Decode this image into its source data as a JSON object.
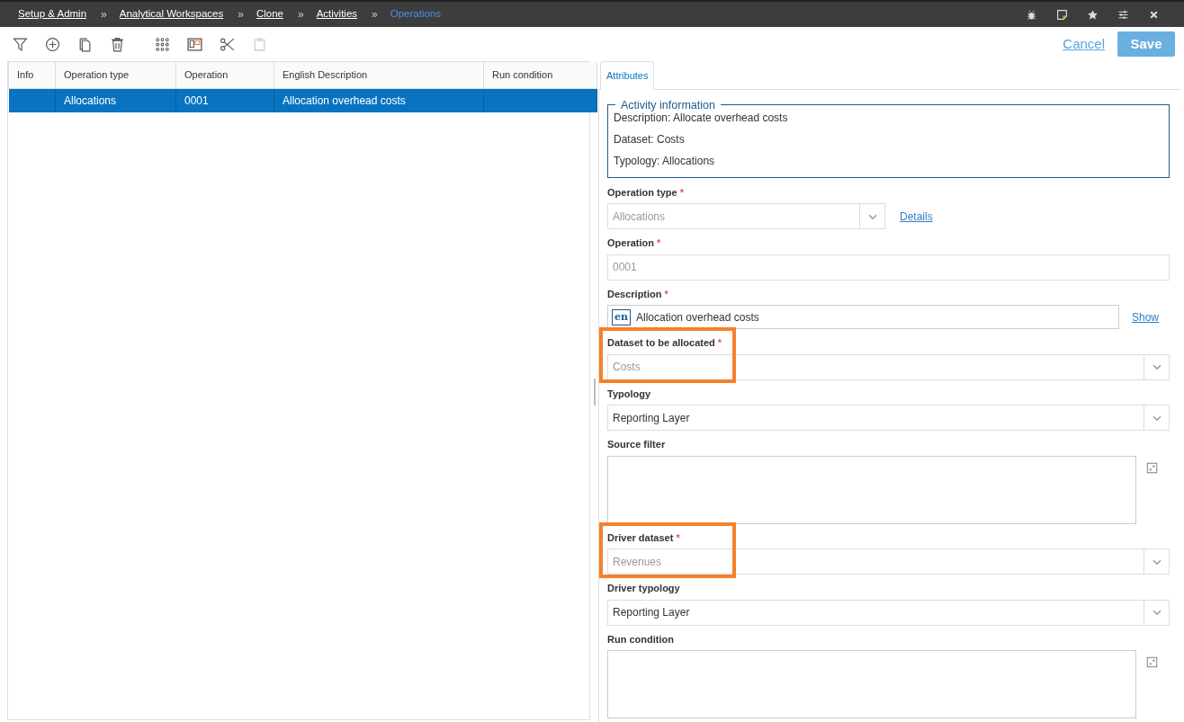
{
  "breadcrumbs": [
    {
      "label": "Setup & Admin",
      "current": false
    },
    {
      "label": "Analytical Workspaces",
      "current": false
    },
    {
      "label": "Clone",
      "current": false
    },
    {
      "label": "Activities",
      "current": false
    },
    {
      "label": "Operations",
      "current": true
    }
  ],
  "separator": "»",
  "required_mark": "*",
  "toolbar": [
    {
      "disabled": false
    },
    {
      "disabled": false
    },
    {
      "disabled": false
    },
    {
      "disabled": false
    },
    {
      "disabled": false
    },
    {
      "disabled": false
    },
    {
      "disabled": false
    },
    {
      "disabled": true
    }
  ],
  "actions": {
    "cancel": "Cancel",
    "save": "Save"
  },
  "table": {
    "columns": [
      "Info",
      "Operation type",
      "Operation",
      "English Description",
      "Run condition"
    ],
    "rows": [
      {
        "selected": true,
        "cells": [
          "",
          "Allocations",
          "0001",
          "Allocation overhead costs",
          ""
        ]
      }
    ]
  },
  "tabs": [
    {
      "label": "Attributes",
      "selected": true
    }
  ],
  "activity_info": {
    "title": "Activity information",
    "lines": [
      "Description: Allocate overhead costs",
      "Dataset: Costs",
      "Typology: Allocations"
    ]
  },
  "fields": [
    {
      "kind": "select",
      "label": "Operation type",
      "required": true,
      "disabled": true,
      "value": "Allocations",
      "link": "Details",
      "highlighted": false
    },
    {
      "kind": "text",
      "label": "Operation",
      "required": true,
      "disabled": true,
      "value": "0001",
      "highlighted": false
    },
    {
      "kind": "lang",
      "label": "Description",
      "required": true,
      "disabled": false,
      "lang": "en",
      "value": "Allocation overhead costs",
      "link": "Show",
      "highlighted": false
    },
    {
      "kind": "select",
      "label": "Dataset to be allocated",
      "required": true,
      "disabled": true,
      "value": "Costs",
      "highlighted": true
    },
    {
      "kind": "select",
      "label": "Typology",
      "required": false,
      "disabled": false,
      "value": "Reporting Layer",
      "highlighted": false
    },
    {
      "kind": "textarea",
      "label": "Source filter",
      "required": false,
      "disabled": false,
      "highlighted": false
    },
    {
      "kind": "select",
      "label": "Driver dataset",
      "required": true,
      "disabled": true,
      "value": "Revenues",
      "highlighted": true
    },
    {
      "kind": "select",
      "label": "Driver typology",
      "required": false,
      "disabled": false,
      "value": "Reporting Layer",
      "highlighted": false
    },
    {
      "kind": "textarea",
      "label": "Run condition",
      "required": false,
      "disabled": false,
      "highlighted": false
    }
  ]
}
